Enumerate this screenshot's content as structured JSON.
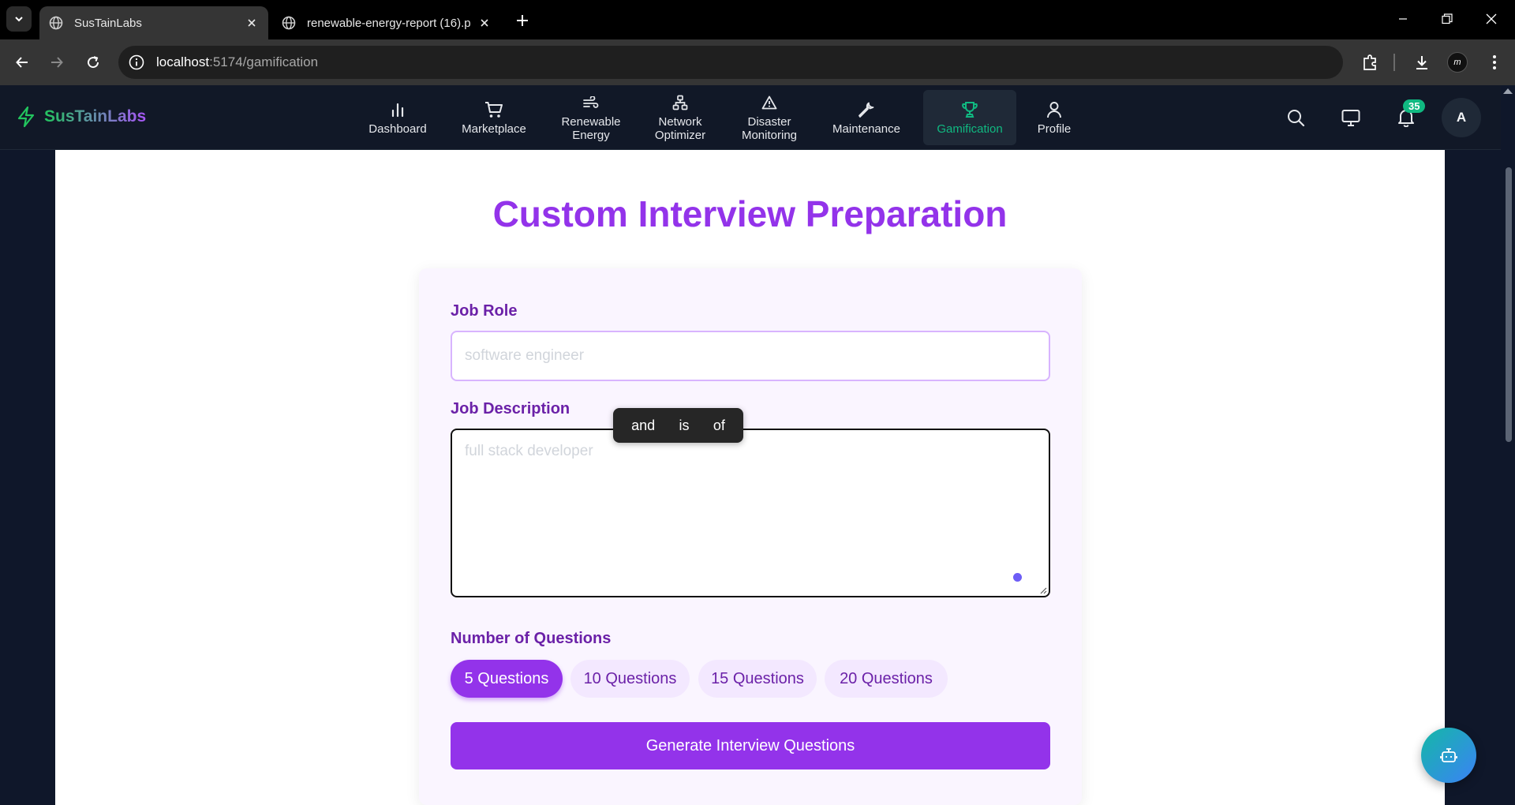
{
  "browser": {
    "tabs": [
      {
        "title": "SusTainLabs",
        "active": true
      },
      {
        "title": "renewable-energy-report (16).p",
        "active": false
      }
    ],
    "url_host": "localhost",
    "url_path": ":5174/gamification"
  },
  "app": {
    "brand": "SusTainLabs",
    "nav": [
      {
        "label": "Dashboard",
        "icon": "bar-chart-icon"
      },
      {
        "label": "Marketplace",
        "icon": "cart-icon"
      },
      {
        "label": "Renewable\nEnergy",
        "icon": "wind-icon"
      },
      {
        "label": "Network\nOptimizer",
        "icon": "network-icon"
      },
      {
        "label": "Disaster\nMonitoring",
        "icon": "warning-icon"
      },
      {
        "label": "Maintenance",
        "icon": "wrench-icon"
      },
      {
        "label": "Gamification",
        "icon": "trophy-icon",
        "active": true
      },
      {
        "label": "Profile",
        "icon": "user-icon"
      }
    ],
    "notification_count": "35",
    "avatar_initial": "A"
  },
  "page": {
    "title": "Custom Interview Preparation",
    "job_role": {
      "label": "Job Role",
      "placeholder": "software engineer",
      "value": ""
    },
    "job_description": {
      "label": "Job Description",
      "placeholder": "full stack developer",
      "value": ""
    },
    "suggestions": [
      "and",
      "is",
      "of"
    ],
    "questions": {
      "label": "Number of Questions",
      "options": [
        "5 Questions",
        "10 Questions",
        "15 Questions",
        "20 Questions"
      ],
      "selected": "5 Questions"
    },
    "generate_button": "Generate Interview Questions"
  },
  "colors": {
    "accent": "#9333ea",
    "active_nav": "#10b981",
    "navbar_bg": "#111827"
  }
}
